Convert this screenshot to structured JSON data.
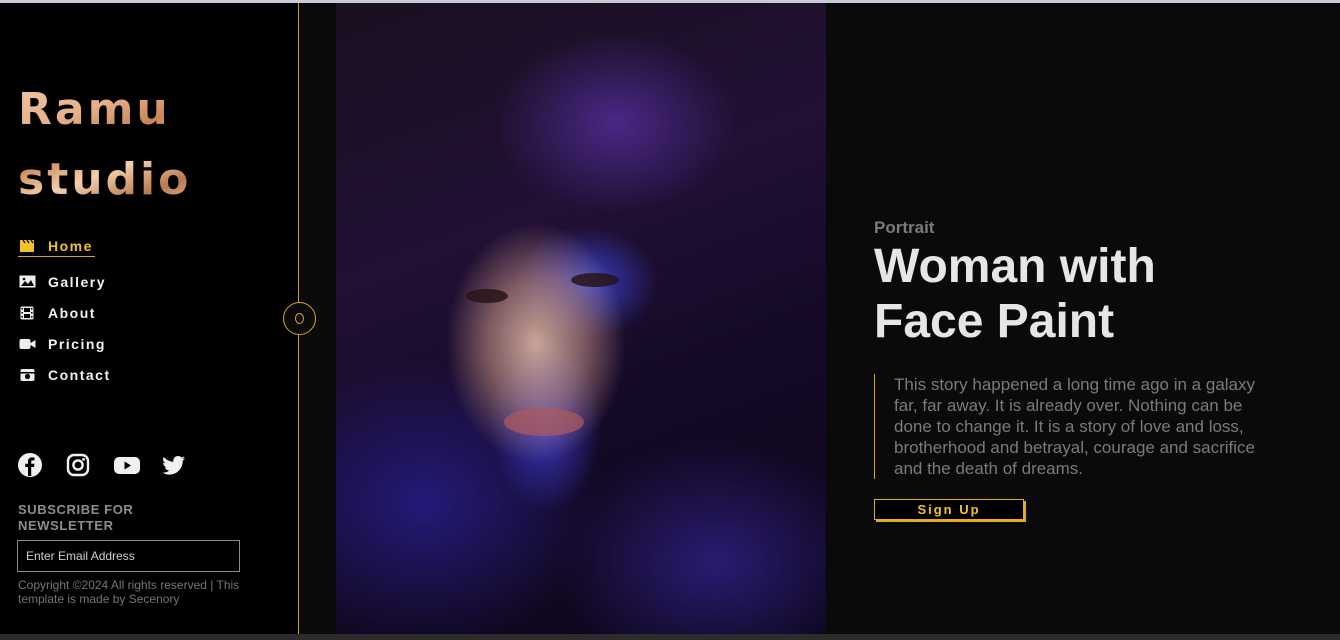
{
  "brand": {
    "line1": "Ramu",
    "line2": "studio"
  },
  "nav": [
    {
      "label": "Home",
      "icon": "clapperboard-icon",
      "active": true
    },
    {
      "label": "Gallery",
      "icon": "image-icon",
      "active": false
    },
    {
      "label": "About",
      "icon": "film-icon",
      "active": false
    },
    {
      "label": "Pricing",
      "icon": "video-camera-icon",
      "active": false
    },
    {
      "label": "Contact",
      "icon": "camera-icon",
      "active": false
    }
  ],
  "social": [
    "facebook-icon",
    "instagram-icon",
    "youtube-icon",
    "twitter-icon"
  ],
  "newsletter": {
    "title": "SUBSCRIBE FOR NEWSLETTER",
    "placeholder": "Enter Email Address"
  },
  "footer": {
    "copyright": "Copyright ©2024 All rights reserved | This template is made by Secenory"
  },
  "hero": {
    "category": "Portrait",
    "title": "Woman with Face Paint",
    "description": "This story happened a long time ago in a galaxy far, far away. It is already over. Nothing can be done to change it. It is a story of love and loss, brotherhood and betrayal, courage and sacrifice and the death of dreams.",
    "button": "Sign Up"
  },
  "colors": {
    "accent": "#f3c22b",
    "border": "#d8a51e",
    "background": "#0a0a0a"
  }
}
